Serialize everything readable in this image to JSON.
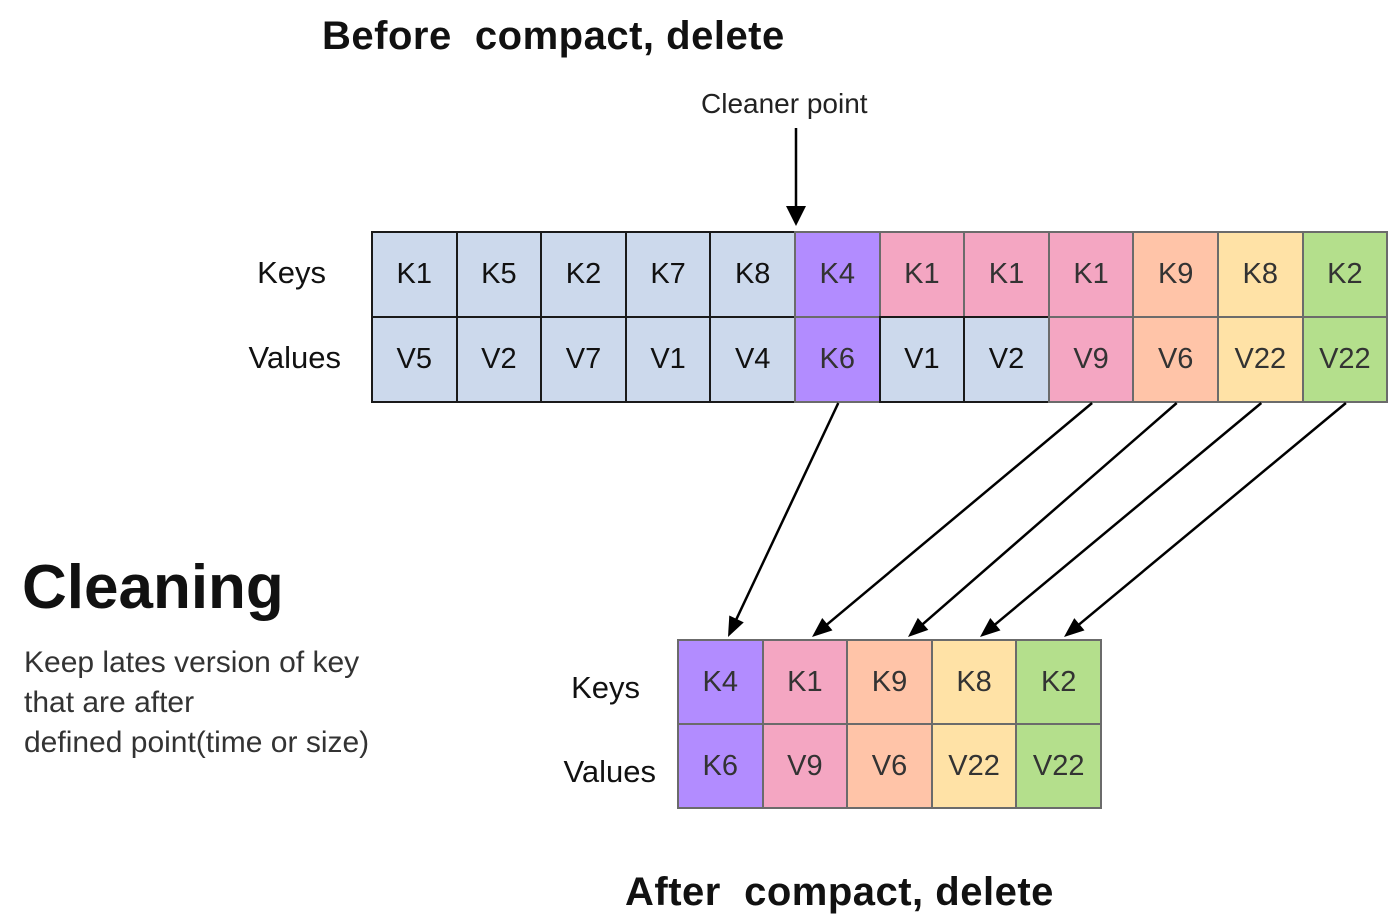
{
  "before": {
    "title": "Before  compact, delete",
    "cleaner_point_label": "Cleaner point",
    "row_labels": {
      "keys": "Keys",
      "values": "Values"
    },
    "cells": [
      {
        "key": "K1",
        "value": "V5",
        "key_color": "#ccd9ec",
        "value_color": "#ccd9ec"
      },
      {
        "key": "K5",
        "value": "V2",
        "key_color": "#ccd9ec",
        "value_color": "#ccd9ec"
      },
      {
        "key": "K2",
        "value": "V7",
        "key_color": "#ccd9ec",
        "value_color": "#ccd9ec"
      },
      {
        "key": "K7",
        "value": "V1",
        "key_color": "#ccd9ec",
        "value_color": "#ccd9ec"
      },
      {
        "key": "K8",
        "value": "V4",
        "key_color": "#ccd9ec",
        "value_color": "#ccd9ec"
      },
      {
        "key": "K4",
        "value": "K6",
        "key_color": "#b28cff",
        "value_color": "#b28cff"
      },
      {
        "key": "K1",
        "value": "V1",
        "key_color": "#f4a6c2",
        "value_color": "#ccd9ec"
      },
      {
        "key": "K1",
        "value": "V2",
        "key_color": "#f4a6c2",
        "value_color": "#ccd9ec"
      },
      {
        "key": "K1",
        "value": "V9",
        "key_color": "#f4a6c2",
        "value_color": "#f4a6c2"
      },
      {
        "key": "K9",
        "value": "V6",
        "key_color": "#ffc4a8",
        "value_color": "#ffc4a8"
      },
      {
        "key": "K8",
        "value": "V22",
        "key_color": "#ffe2a6",
        "value_color": "#ffe2a6"
      },
      {
        "key": "K2",
        "value": "V22",
        "key_color": "#b4df8c",
        "value_color": "#b4df8c"
      }
    ]
  },
  "after": {
    "title": "After  compact, delete",
    "row_labels": {
      "keys": "Keys",
      "values": "Values"
    },
    "cells": [
      {
        "key": "K4",
        "value": "K6",
        "color": "#b28cff"
      },
      {
        "key": "K1",
        "value": "V9",
        "color": "#f4a6c2"
      },
      {
        "key": "K9",
        "value": "V6",
        "color": "#ffc4a8"
      },
      {
        "key": "K8",
        "value": "V22",
        "color": "#ffe2a6"
      },
      {
        "key": "K2",
        "value": "V22",
        "color": "#b4df8c"
      }
    ]
  },
  "mapping": [
    {
      "from_index": 5,
      "to_index": 0
    },
    {
      "from_index": 8,
      "to_index": 1
    },
    {
      "from_index": 9,
      "to_index": 2
    },
    {
      "from_index": 10,
      "to_index": 3
    },
    {
      "from_index": 11,
      "to_index": 4
    }
  ],
  "cleaning": {
    "title": "Cleaning",
    "description_lines": [
      "Keep lates version of key",
      "that are after",
      "defined point(time or size)"
    ]
  }
}
